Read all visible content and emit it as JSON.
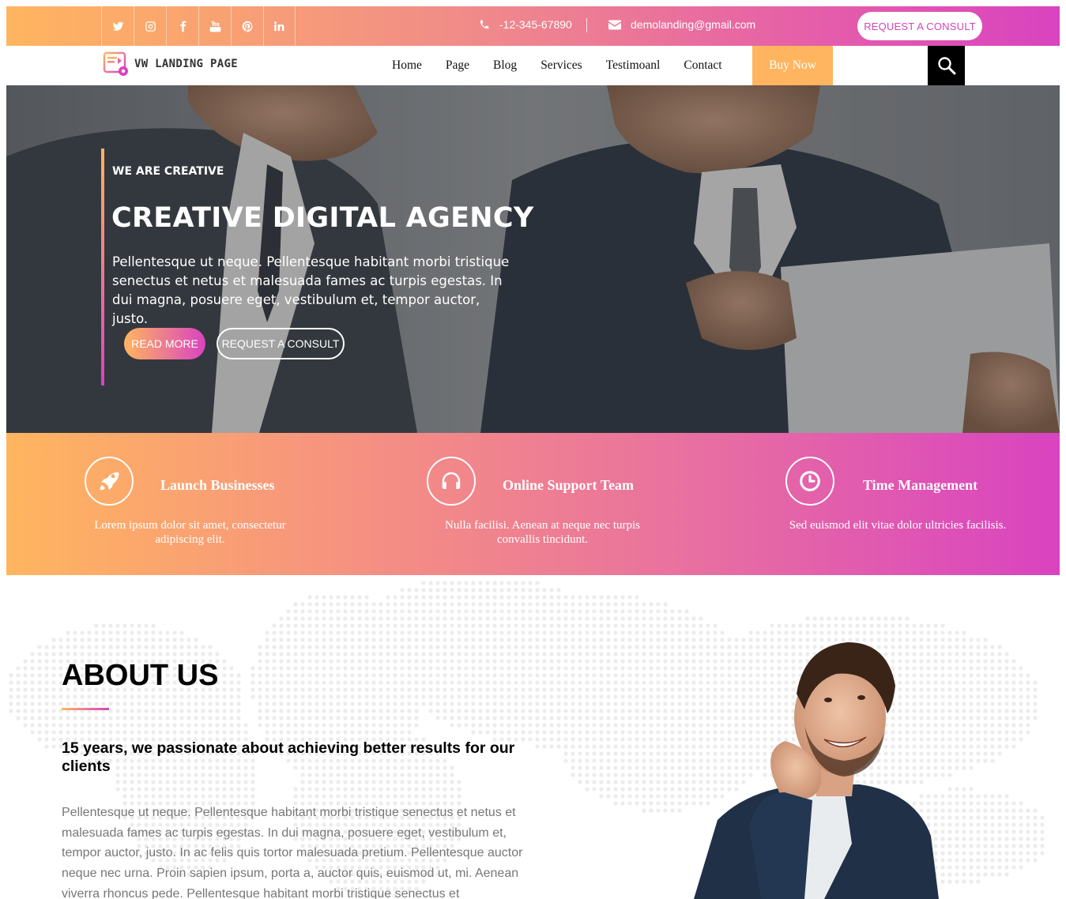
{
  "topbar": {
    "socials": [
      {
        "icon": "twitter-icon"
      },
      {
        "icon": "instagram-icon"
      },
      {
        "icon": "facebook-icon"
      },
      {
        "icon": "youtube-icon"
      },
      {
        "icon": "pinterest-icon"
      },
      {
        "icon": "linkedin-icon"
      }
    ],
    "phone": "-12-345-67890",
    "email": "demolanding@gmail.com",
    "consult_label": "REQUEST A CONSULT"
  },
  "nav": {
    "logo_text": "VW LANDING PAGE",
    "items": [
      "Home",
      "Page",
      "Blog",
      "Services",
      "Testimoanl",
      "Contact"
    ],
    "buy_label": "Buy Now"
  },
  "hero": {
    "kicker": "WE ARE CREATIVE",
    "title": "CREATIVE DIGITAL AGENCY",
    "text": "Pellentesque ut neque. Pellentesque habitant morbi tristique senectus et netus et malesuada fames ac turpis egestas. In dui magna, posuere eget, vestibulum et, tempor auctor, justo.",
    "read_more": "READ MORE",
    "consult": "REQUEST A CONSULT"
  },
  "features": [
    {
      "icon": "rocket-icon",
      "title": "Launch Businesses",
      "text": "Lorem ipsum dolor sit amet, consectetur adipiscing elit."
    },
    {
      "icon": "headphones-icon",
      "title": "Online Support Team",
      "text": "Nulla facilisi. Aenean at neque nec turpis convallis tincidunt."
    },
    {
      "icon": "clock-icon",
      "title": "Time Management",
      "text": "Sed euismod elit vitae dolor ultricies facilisis."
    }
  ],
  "about": {
    "title": "ABOUT US",
    "subtitle": "15 years, we passionate about achieving better results for our clients",
    "text": "Pellentesque ut neque. Pellentesque habitant morbi tristique senectus et netus et malesuada fames ac turpis egestas. In dui magna, posuere eget, vestibulum et, tempor auctor, justo. In ac felis quis tortor malesuada pretium. Pellentesque auctor neque nec urna. Proin sapien ipsum, porta a, auctor quis, euismod ut, mi. Aenean viverra rhoncus pede. Pellentesque habitant morbi tristique senectus et"
  },
  "colors": {
    "gradient_start": "#ffb55f",
    "gradient_end": "#d943c0",
    "accent_pink": "#d244b8"
  }
}
